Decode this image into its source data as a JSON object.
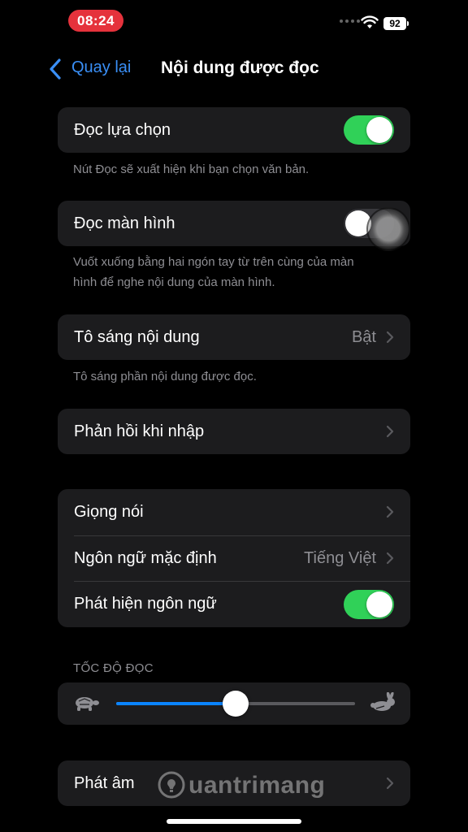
{
  "status_bar": {
    "time": "08:24",
    "battery": "92"
  },
  "nav": {
    "back_label": "Quay lại",
    "title": "Nội dung được đọc"
  },
  "speak_selection": {
    "label": "Đọc lựa chọn",
    "toggle": true,
    "footer": "Nút Đọc sẽ xuất hiện khi bạn chọn văn bản."
  },
  "speak_screen": {
    "label": "Đọc màn hình",
    "toggle": false,
    "footer_line1": "Vuốt xuống bằng hai ngón tay từ trên cùng của màn",
    "footer_line2": "hình để nghe nội dung của màn hình."
  },
  "highlight": {
    "label": "Tô sáng nội dung",
    "value": "Bật",
    "footer": "Tô sáng phần nội dung được đọc."
  },
  "typing_feedback": {
    "label": "Phản hồi khi nhập"
  },
  "voice_group": {
    "voices": {
      "label": "Giọng nói"
    },
    "default_language": {
      "label": "Ngôn ngữ mặc định",
      "value": "Tiếng Việt"
    },
    "detect_language": {
      "label": "Phát hiện ngôn ngữ",
      "toggle": true
    }
  },
  "speaking_rate": {
    "header": "TỐC ĐỘ ĐỌC",
    "value": 0.5
  },
  "pronunciations": {
    "label": "Phát âm"
  },
  "watermark": {
    "text": "uantrimang"
  },
  "colors": {
    "accent_blue": "#0a84ff",
    "toggle_on": "#30d158",
    "cell_bg": "#1c1c1e"
  }
}
